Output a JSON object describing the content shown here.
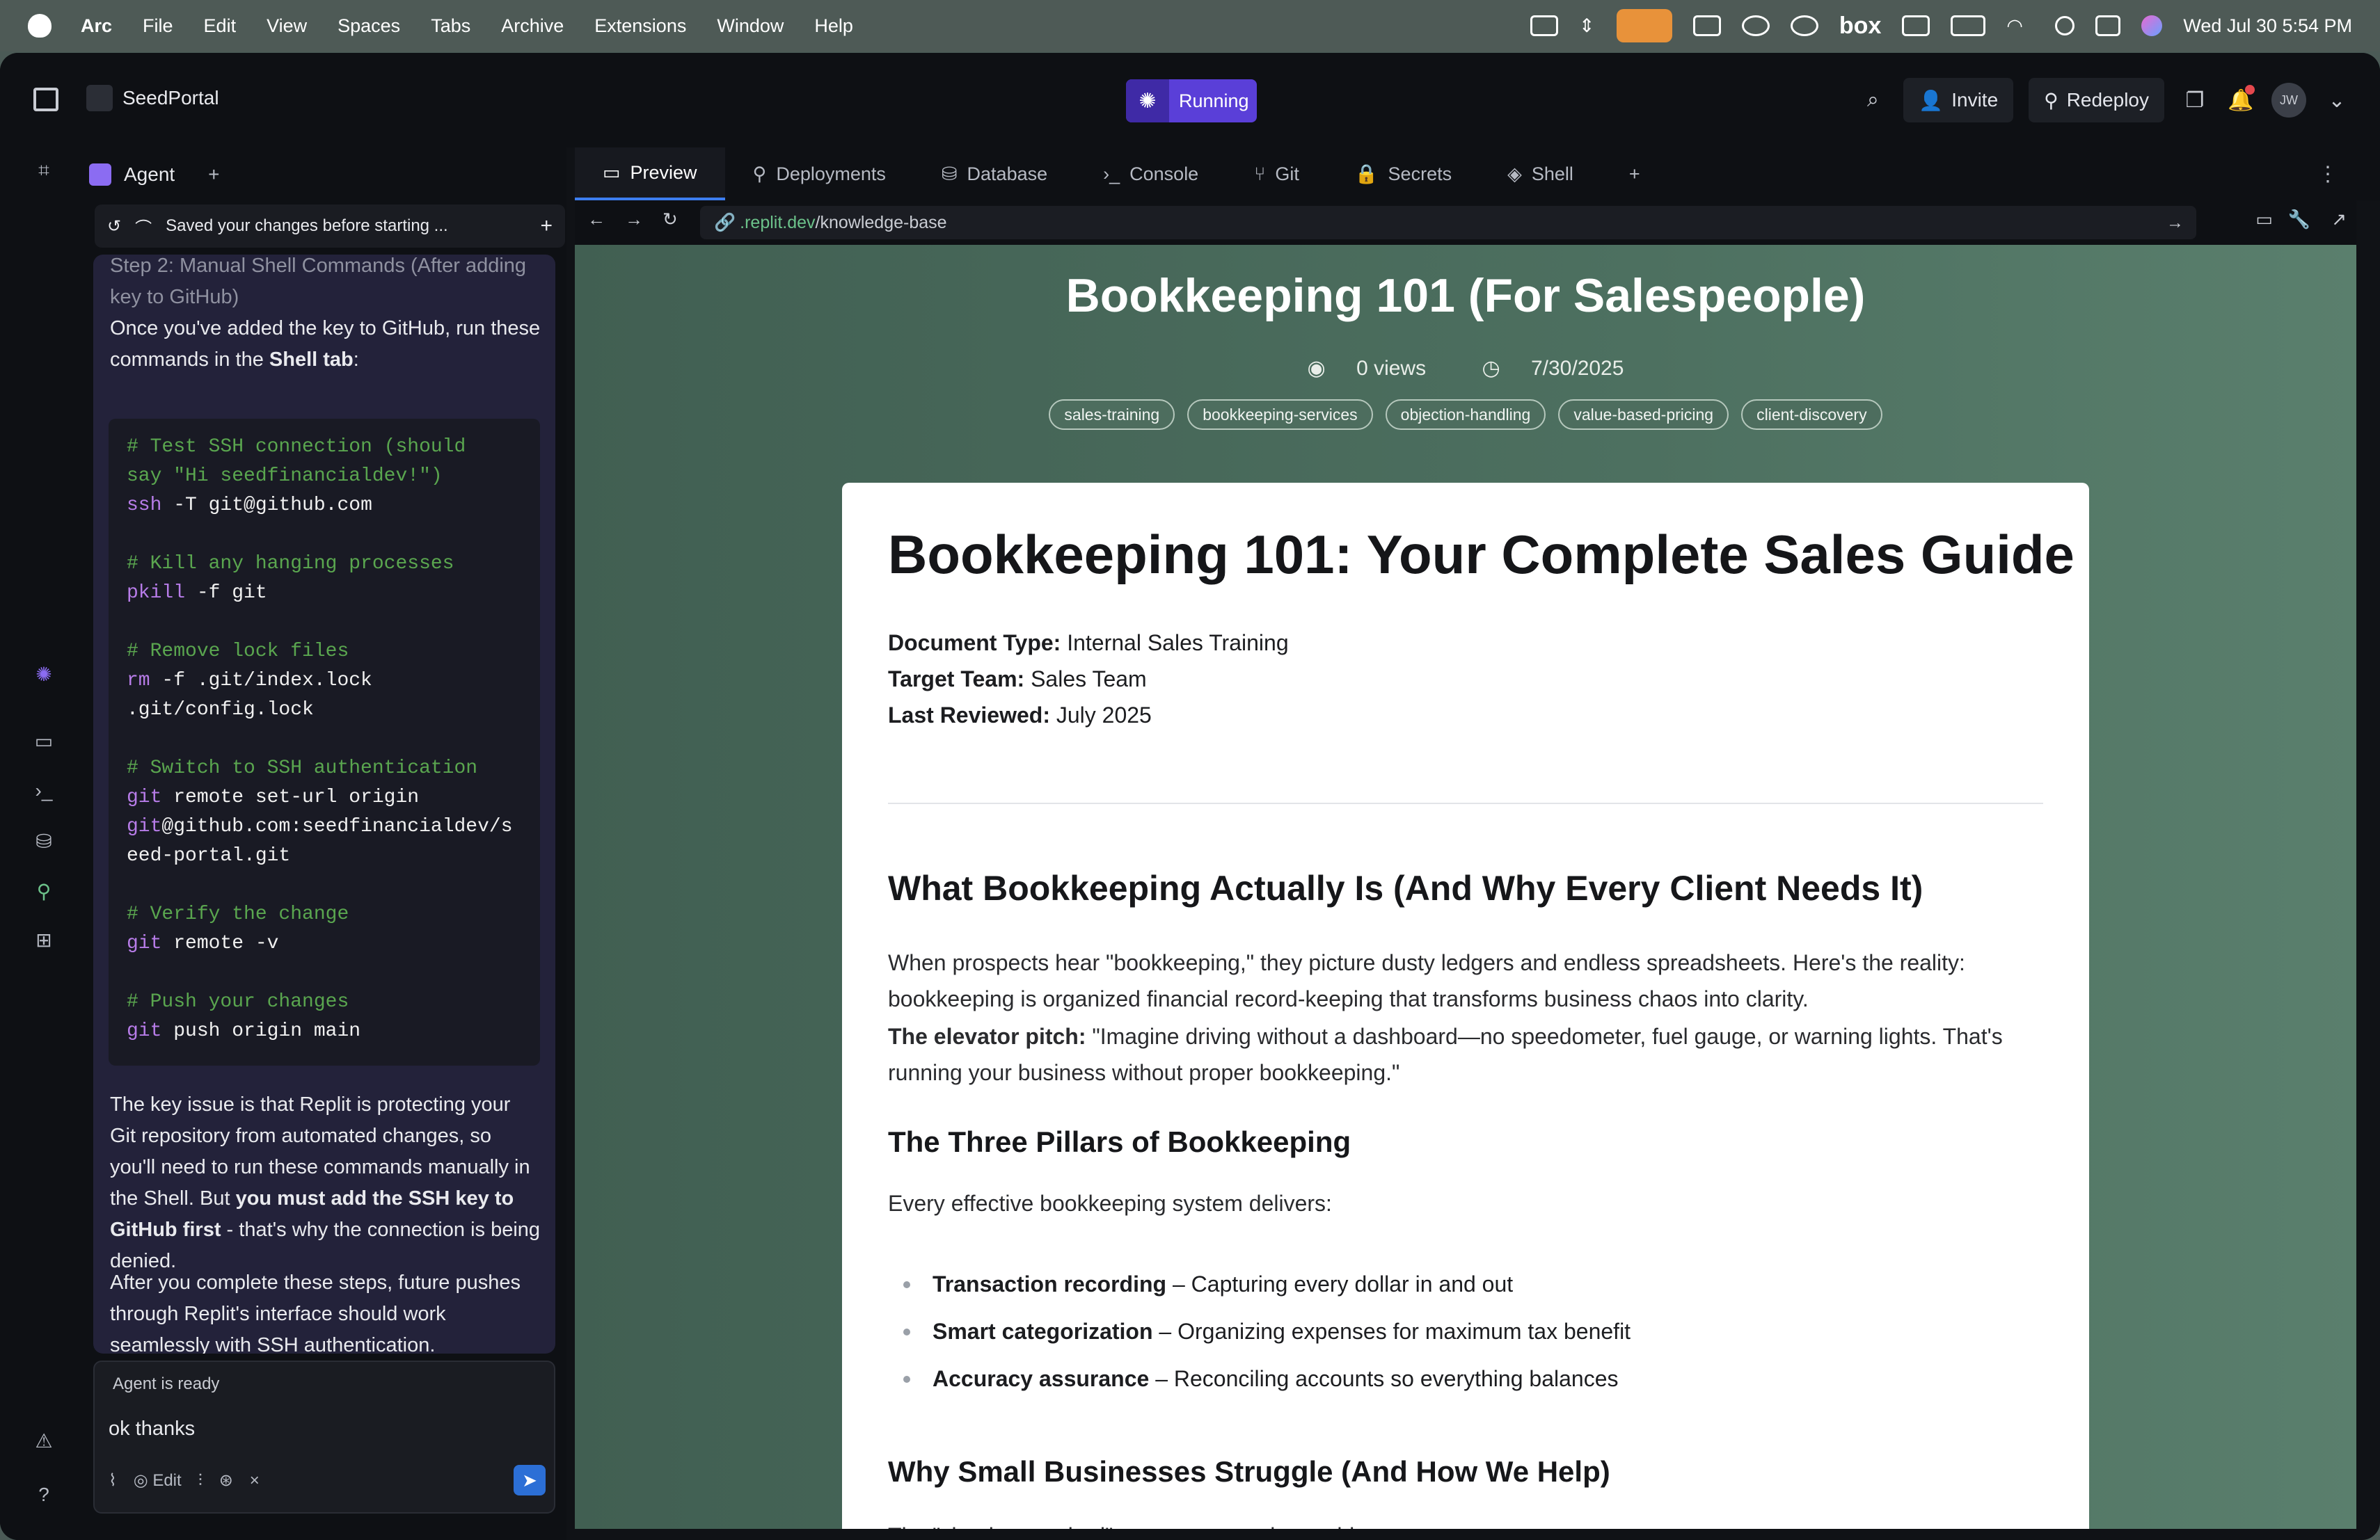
{
  "menubar": {
    "app": "Arc",
    "items": [
      "File",
      "Edit",
      "View",
      "Spaces",
      "Tabs",
      "Archive",
      "Extensions",
      "Window",
      "Help"
    ],
    "status_icons": [
      "drive-icon",
      "arrows-icon",
      "microphone-icon",
      "mail-icon",
      "openai-icon",
      "cloud-icon",
      "box-icon",
      "windows-icon",
      "battery-icon",
      "wifi-icon",
      "search-icon",
      "control-center-icon",
      "siri-icon"
    ],
    "box_label": "box",
    "clock": "Wed Jul 30  5:54 PM"
  },
  "topbar": {
    "project": "SeedPortal",
    "status": "Running",
    "invite": "Invite",
    "redeploy": "Redeploy",
    "avatar_initials": "JW"
  },
  "agent": {
    "tab_label": "Agent",
    "saved_notice": "Saved your changes before starting ...",
    "step_heading": "Step 2: Manual Shell Commands (After adding key to GitHub)",
    "intro": "Once you've added the key to GitHub, run these commands in the ",
    "intro_bold": "Shell tab",
    "intro_end": ":",
    "code": [
      {
        "c": "# Test SSH connection (should"
      },
      {
        "c": "say \"Hi seedfinancialdev!\")"
      },
      {
        "t": "ssh -T git@github.com"
      },
      {
        "t": ""
      },
      {
        "c": "# Kill any hanging processes"
      },
      {
        "t": "pkill -f git"
      },
      {
        "t": ""
      },
      {
        "c": "# Remove lock files"
      },
      {
        "t": "rm -f .git/index.lock"
      },
      {
        "t": ".git/config.lock"
      },
      {
        "t": ""
      },
      {
        "c": "# Switch to SSH authentication"
      },
      {
        "t": "git remote set-url origin"
      },
      {
        "t": "git@github.com:seedfinancialdev/s"
      },
      {
        "t": "eed-portal.git"
      },
      {
        "t": ""
      },
      {
        "c": "# Verify the change"
      },
      {
        "t": "git remote -v"
      },
      {
        "t": ""
      },
      {
        "c": "# Push your changes"
      },
      {
        "t": "git push origin main"
      }
    ],
    "para1_a": "The key issue is that Replit is protecting your Git repository from automated changes, so you'll need to run these commands manually in the Shell. But ",
    "para1_bold": "you must add the SSH key to GitHub first",
    "para1_b": " - that's why the connection is being denied.",
    "para2": "After you complete these steps, future pushes through Replit's interface should work seamlessly with SSH authentication.",
    "input_status": "Agent is ready",
    "input_value": "ok thanks",
    "edit_label": "Edit"
  },
  "tabs": [
    "Preview",
    "Deployments",
    "Database",
    "Console",
    "Git",
    "Secrets",
    "Shell"
  ],
  "url": {
    "domain": ".replit.dev",
    "path": "/knowledge-base"
  },
  "page": {
    "title": "Bookkeeping 101 (For Salespeople)",
    "views": "0 views",
    "date": "7/30/2025",
    "tags": [
      "sales-training",
      "bookkeeping-services",
      "objection-handling",
      "value-based-pricing",
      "client-discovery"
    ],
    "h1": "Bookkeeping 101: Your Complete Sales Guide",
    "meta": [
      {
        "k": "Document Type:",
        "v": " Internal Sales Training"
      },
      {
        "k": "Target Team:",
        "v": " Sales Team"
      },
      {
        "k": "Last Reviewed:",
        "v": " July 2025"
      }
    ],
    "h2a": "What Bookkeeping Actually Is (And Why Every Client Needs It)",
    "p1": "When prospects hear \"bookkeeping,\" they picture dusty ledgers and endless spreadsheets. Here's the reality: bookkeeping is organized financial record-keeping that transforms business chaos into clarity.",
    "pitch_k": "The elevator pitch:",
    "pitch_v": " \"Imagine driving without a dashboard—no speedometer, fuel gauge, or warning lights. That's running your business without proper bookkeeping.\"",
    "h3": "The Three Pillars of Bookkeeping",
    "p2": "Every effective bookkeeping system delivers:",
    "pillars": [
      {
        "k": "Transaction recording",
        "v": " – Capturing every dollar in and out"
      },
      {
        "k": "Smart categorization",
        "v": " – Organizing expenses for maximum tax benefit"
      },
      {
        "k": "Accuracy assurance",
        "v": " – Reconciling accounts so everything balances"
      }
    ],
    "h2b": "Why Small Businesses Struggle (And How We Help)",
    "p3": "The \"shoebox method\" creates expensive problems:"
  }
}
